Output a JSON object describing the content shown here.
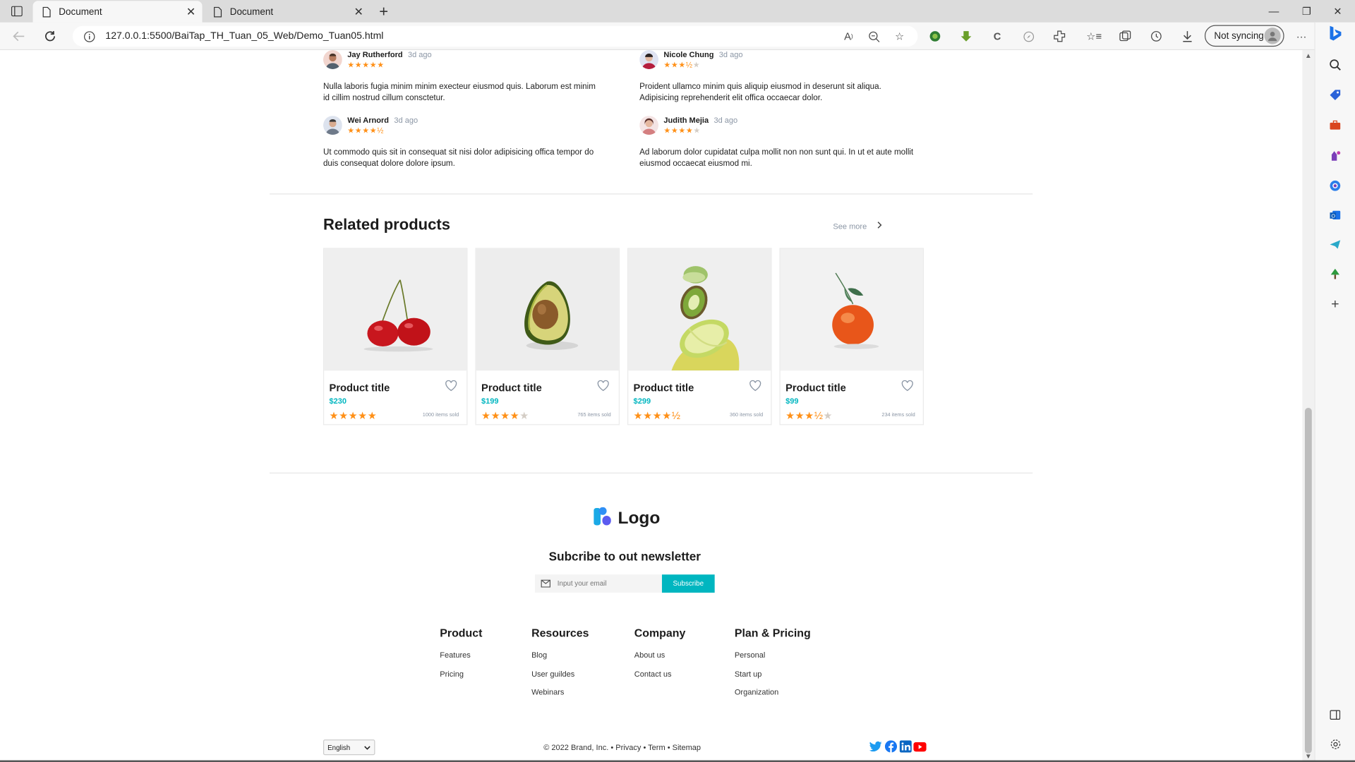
{
  "browser": {
    "tabs": [
      {
        "title": "Document",
        "active": true
      },
      {
        "title": "Document",
        "active": false
      }
    ],
    "url": {
      "host": "127.0.0.1",
      "rest": ":5500/BaiTap_TH_Tuan_05_Web/Demo_Tuan05.html"
    },
    "sync_label": "Not syncing",
    "accent": "#1a73e8"
  },
  "reviews": [
    {
      "name": "Jay Rutherford",
      "time": "3d ago",
      "stars": "★★★★★",
      "stars_off": "",
      "text": "Nulla laboris fugia minim minim execteur eiusmod quis. Laborum est minim id cillim nostrud cillum consctetur."
    },
    {
      "name": "Nicole Chung",
      "time": "3d ago",
      "stars": "★★★½",
      "stars_off": "★",
      "text": "Proident ullamco minim quis aliquip eiusmod in deserunt sit aliqua. Adipisicing reprehenderit elit offica occaecar dolor."
    },
    {
      "name": "Wei Arnord",
      "time": "3d ago",
      "stars": "★★★★½",
      "stars_off": "",
      "text": "Ut commodo quis sit in consequat sit nisi dolor adipisicing offica tempor do duis consequat dolore dolore ipsum."
    },
    {
      "name": "Judith Mejia",
      "time": "3d ago",
      "stars": "★★★★",
      "stars_off": "★",
      "text": "Ad laborum dolor cupidatat culpa mollit non non sunt qui. In ut et aute mollit eiusmod occaecat eiusmod mi."
    }
  ],
  "related": {
    "title": "Related products",
    "see_more": "See more",
    "products": [
      {
        "title": "Product title",
        "price": "$230",
        "stars_on": "★★★★★",
        "stars_off": "",
        "sold": "1000 items sold",
        "image": "cherry"
      },
      {
        "title": "Product title",
        "price": "$199",
        "stars_on": "★★★★",
        "stars_off": "★",
        "sold": "765 items sold",
        "image": "avocado"
      },
      {
        "title": "Product title",
        "price": "$299",
        "stars_on": "★★★★½",
        "stars_off": "",
        "sold": "360 items sold",
        "image": "kiwi-lime"
      },
      {
        "title": "Product title",
        "price": "$99",
        "stars_on": "★★★½",
        "stars_off": "★",
        "sold": "234 items sold",
        "image": "tangerine"
      }
    ]
  },
  "footer": {
    "logo_text": "Logo",
    "newsletter_title": "Subcribe to out newsletter",
    "email_placeholder": "Input your email",
    "subscribe_label": "Subscribe",
    "columns": [
      {
        "heading": "Product",
        "links": [
          "Features",
          "Pricing"
        ]
      },
      {
        "heading": "Resources",
        "links": [
          "Blog",
          "User guildes",
          "Webinars"
        ]
      },
      {
        "heading": "Company",
        "links": [
          "About us",
          "Contact us"
        ]
      },
      {
        "heading": "Plan & Pricing",
        "links": [
          "Personal",
          "Start up",
          "Organization"
        ]
      }
    ],
    "language": "English",
    "copyright": "© 2022 Brand, Inc. • Privacy • Term • Sitemap",
    "socials": [
      "twitter-icon",
      "facebook-icon",
      "linkedin-icon",
      "youtube-icon"
    ],
    "brand_color": "#00b6c0",
    "star_color": "#ff9017"
  }
}
